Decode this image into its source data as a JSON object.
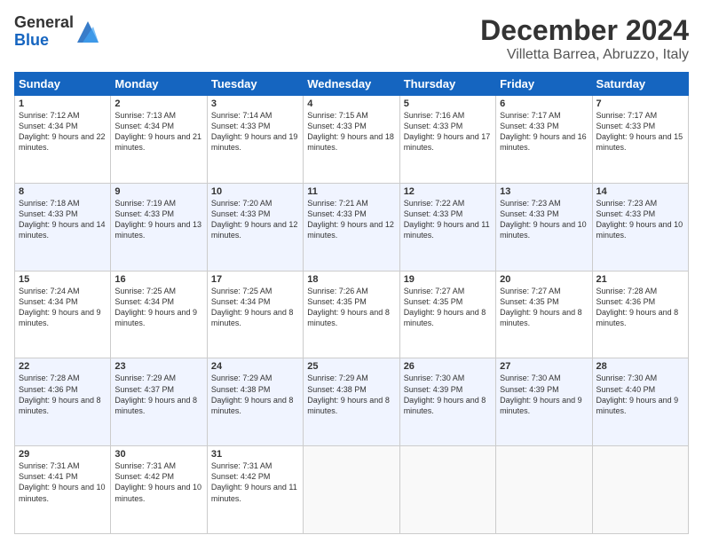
{
  "header": {
    "logo_general": "General",
    "logo_blue": "Blue",
    "month_title": "December 2024",
    "location": "Villetta Barrea, Abruzzo, Italy"
  },
  "days_of_week": [
    "Sunday",
    "Monday",
    "Tuesday",
    "Wednesday",
    "Thursday",
    "Friday",
    "Saturday"
  ],
  "weeks": [
    [
      {
        "day": "1",
        "sunrise": "7:12 AM",
        "sunset": "4:34 PM",
        "daylight": "9 hours and 22 minutes."
      },
      {
        "day": "2",
        "sunrise": "7:13 AM",
        "sunset": "4:34 PM",
        "daylight": "9 hours and 21 minutes."
      },
      {
        "day": "3",
        "sunrise": "7:14 AM",
        "sunset": "4:33 PM",
        "daylight": "9 hours and 19 minutes."
      },
      {
        "day": "4",
        "sunrise": "7:15 AM",
        "sunset": "4:33 PM",
        "daylight": "9 hours and 18 minutes."
      },
      {
        "day": "5",
        "sunrise": "7:16 AM",
        "sunset": "4:33 PM",
        "daylight": "9 hours and 17 minutes."
      },
      {
        "day": "6",
        "sunrise": "7:17 AM",
        "sunset": "4:33 PM",
        "daylight": "9 hours and 16 minutes."
      },
      {
        "day": "7",
        "sunrise": "7:17 AM",
        "sunset": "4:33 PM",
        "daylight": "9 hours and 15 minutes."
      }
    ],
    [
      {
        "day": "8",
        "sunrise": "7:18 AM",
        "sunset": "4:33 PM",
        "daylight": "9 hours and 14 minutes."
      },
      {
        "day": "9",
        "sunrise": "7:19 AM",
        "sunset": "4:33 PM",
        "daylight": "9 hours and 13 minutes."
      },
      {
        "day": "10",
        "sunrise": "7:20 AM",
        "sunset": "4:33 PM",
        "daylight": "9 hours and 12 minutes."
      },
      {
        "day": "11",
        "sunrise": "7:21 AM",
        "sunset": "4:33 PM",
        "daylight": "9 hours and 12 minutes."
      },
      {
        "day": "12",
        "sunrise": "7:22 AM",
        "sunset": "4:33 PM",
        "daylight": "9 hours and 11 minutes."
      },
      {
        "day": "13",
        "sunrise": "7:23 AM",
        "sunset": "4:33 PM",
        "daylight": "9 hours and 10 minutes."
      },
      {
        "day": "14",
        "sunrise": "7:23 AM",
        "sunset": "4:33 PM",
        "daylight": "9 hours and 10 minutes."
      }
    ],
    [
      {
        "day": "15",
        "sunrise": "7:24 AM",
        "sunset": "4:34 PM",
        "daylight": "9 hours and 9 minutes."
      },
      {
        "day": "16",
        "sunrise": "7:25 AM",
        "sunset": "4:34 PM",
        "daylight": "9 hours and 9 minutes."
      },
      {
        "day": "17",
        "sunrise": "7:25 AM",
        "sunset": "4:34 PM",
        "daylight": "9 hours and 8 minutes."
      },
      {
        "day": "18",
        "sunrise": "7:26 AM",
        "sunset": "4:35 PM",
        "daylight": "9 hours and 8 minutes."
      },
      {
        "day": "19",
        "sunrise": "7:27 AM",
        "sunset": "4:35 PM",
        "daylight": "9 hours and 8 minutes."
      },
      {
        "day": "20",
        "sunrise": "7:27 AM",
        "sunset": "4:35 PM",
        "daylight": "9 hours and 8 minutes."
      },
      {
        "day": "21",
        "sunrise": "7:28 AM",
        "sunset": "4:36 PM",
        "daylight": "9 hours and 8 minutes."
      }
    ],
    [
      {
        "day": "22",
        "sunrise": "7:28 AM",
        "sunset": "4:36 PM",
        "daylight": "9 hours and 8 minutes."
      },
      {
        "day": "23",
        "sunrise": "7:29 AM",
        "sunset": "4:37 PM",
        "daylight": "9 hours and 8 minutes."
      },
      {
        "day": "24",
        "sunrise": "7:29 AM",
        "sunset": "4:38 PM",
        "daylight": "9 hours and 8 minutes."
      },
      {
        "day": "25",
        "sunrise": "7:29 AM",
        "sunset": "4:38 PM",
        "daylight": "9 hours and 8 minutes."
      },
      {
        "day": "26",
        "sunrise": "7:30 AM",
        "sunset": "4:39 PM",
        "daylight": "9 hours and 8 minutes."
      },
      {
        "day": "27",
        "sunrise": "7:30 AM",
        "sunset": "4:39 PM",
        "daylight": "9 hours and 9 minutes."
      },
      {
        "day": "28",
        "sunrise": "7:30 AM",
        "sunset": "4:40 PM",
        "daylight": "9 hours and 9 minutes."
      }
    ],
    [
      {
        "day": "29",
        "sunrise": "7:31 AM",
        "sunset": "4:41 PM",
        "daylight": "9 hours and 10 minutes."
      },
      {
        "day": "30",
        "sunrise": "7:31 AM",
        "sunset": "4:42 PM",
        "daylight": "9 hours and 10 minutes."
      },
      {
        "day": "31",
        "sunrise": "7:31 AM",
        "sunset": "4:42 PM",
        "daylight": "9 hours and 11 minutes."
      },
      null,
      null,
      null,
      null
    ]
  ]
}
